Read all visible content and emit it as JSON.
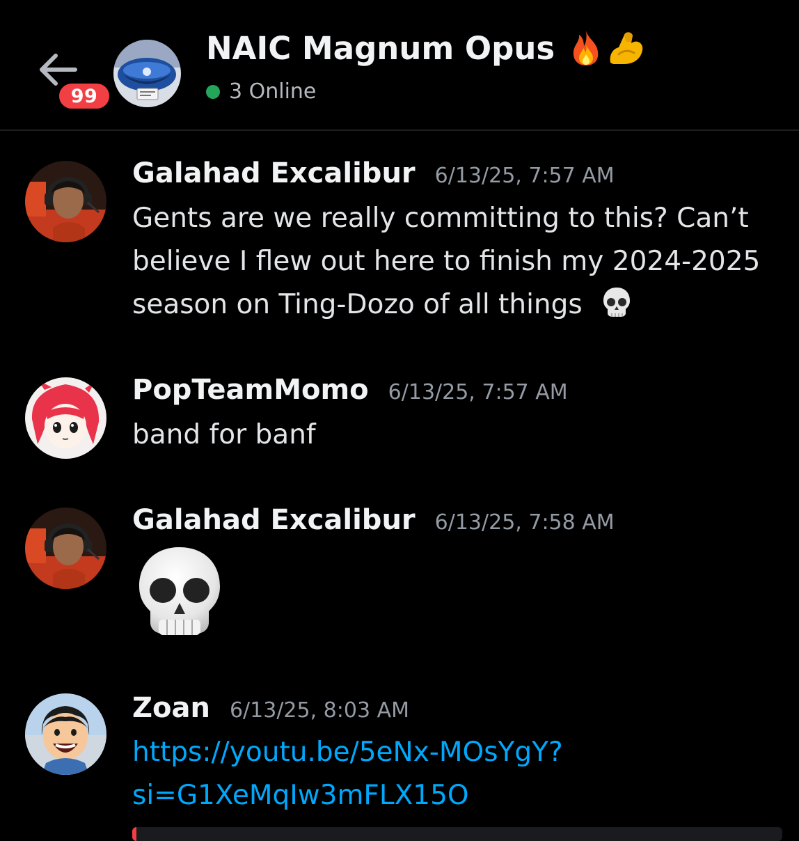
{
  "header": {
    "back_label": "",
    "unread_count": "99",
    "channel_title": "NAIC Magnum Opus",
    "title_emojis": [
      "fire",
      "flexed-biceps"
    ],
    "online_status": "3 Online"
  },
  "messages": [
    {
      "author": "Galahad Excalibur",
      "timestamp": "6/13/25, 7:57 AM",
      "lines": [
        "Gents are we really committing to this?  Can’t",
        "believe I flew out here to finish my 2024-2025",
        "season on Ting-Dozo of all things"
      ],
      "trailing_emoji": "skull"
    },
    {
      "author": "PopTeamMomo",
      "timestamp": "6/13/25, 7:57 AM",
      "lines": [
        "band for banf"
      ]
    },
    {
      "author": "Galahad Excalibur",
      "timestamp": "6/13/25, 7:58 AM",
      "jumbo_emoji": "skull"
    },
    {
      "author": "Zoan",
      "timestamp": "6/13/25, 8:03 AM",
      "link_lines": [
        "https://youtu.be/5eNx-MOsYgY?",
        "si=G1XeMqIw3mFLX15O"
      ]
    }
  ],
  "colors": {
    "background": "#000000",
    "online": "#23a55a",
    "badge": "#f23f43",
    "link": "#00a8fc",
    "timestamp": "#949ba4"
  }
}
